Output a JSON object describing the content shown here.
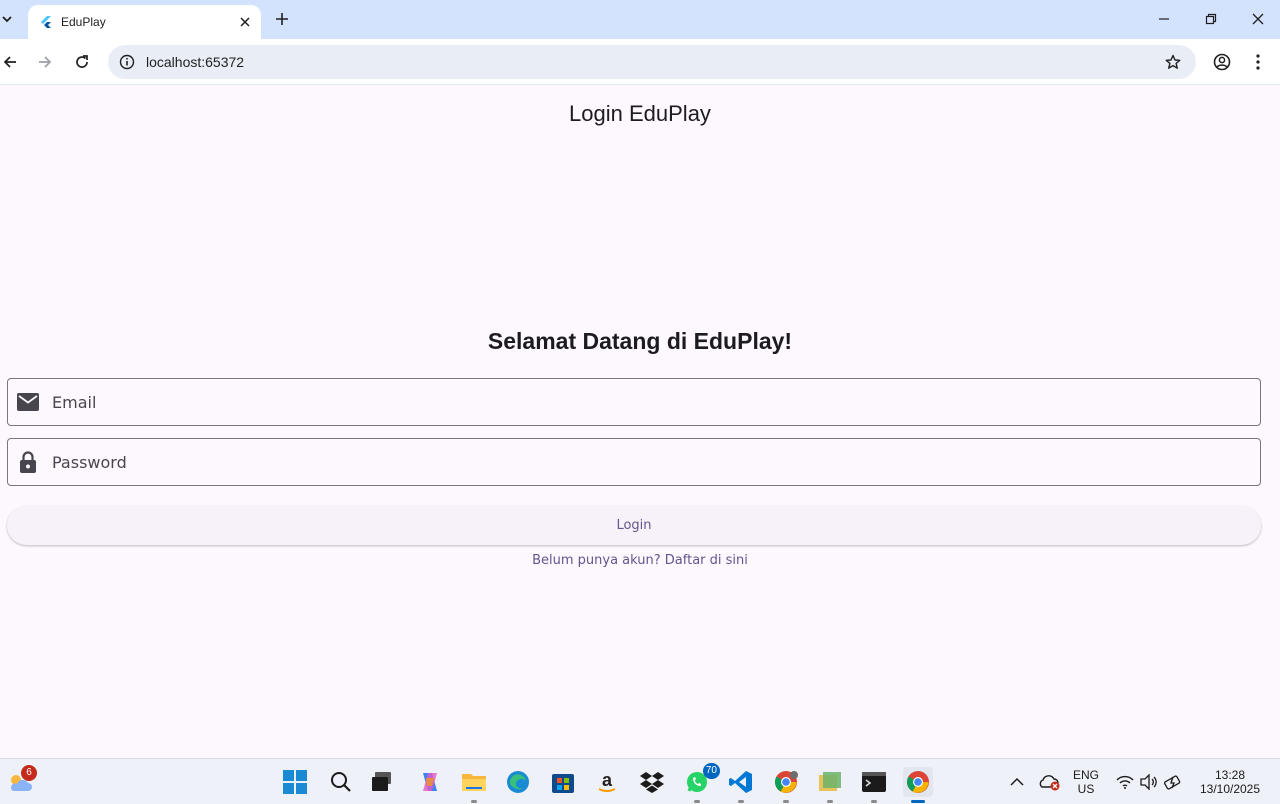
{
  "browser": {
    "tab_title": "EduPlay",
    "url": "localhost:65372"
  },
  "page": {
    "appbar_title": "Login EduPlay",
    "welcome": "Selamat Datang di EduPlay!",
    "email_placeholder": "Email",
    "password_placeholder": "Password",
    "login_label": "Login",
    "register_link": "Belum punya akun? Daftar di sini"
  },
  "taskbar": {
    "widgets_badge": "6",
    "whatsapp_badge": "70",
    "lang_line1": "ENG",
    "lang_line2": "US",
    "time": "13:28",
    "date": "13/10/2025"
  },
  "colors": {
    "tabstrip_bg": "#d3e3fd",
    "page_bg": "#fdf7fe",
    "accent_text": "#65558f",
    "field_border": "#79747e"
  }
}
